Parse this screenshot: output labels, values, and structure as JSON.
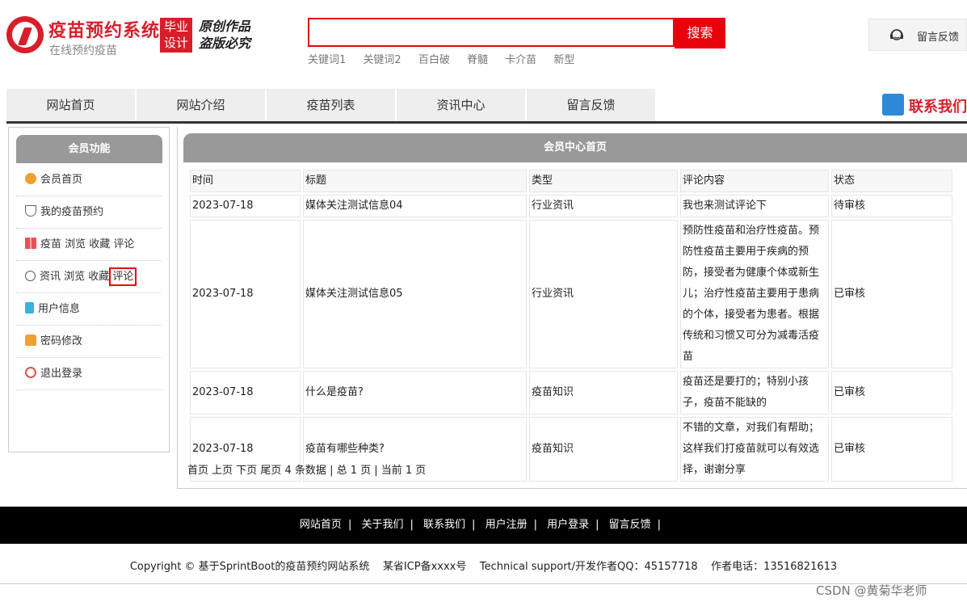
{
  "header": {
    "site_title": "疫苗预约系统",
    "site_subtitle": "在线预约疫苗",
    "badge_line1": "毕业",
    "badge_line2": "设计",
    "slogan_line1": "原创作品",
    "slogan_line2": "盗版必究",
    "search_value": "",
    "search_button": "搜索",
    "keywords": [
      "关键词1",
      "关键词2",
      "百白破",
      "脊髓",
      "卡介苗",
      "新型"
    ],
    "feedback_label": "留言反馈"
  },
  "nav": {
    "items": [
      "网站首页",
      "网站介绍",
      "疫苗列表",
      "资讯中心",
      "留言反馈"
    ],
    "contact_label": "联系我们"
  },
  "sidebar": {
    "title": "会员功能",
    "items": [
      {
        "label": "会员首页",
        "icon": "home-icon",
        "color": "#f0a030"
      },
      {
        "label": "我的疫苗预约",
        "icon": "heart-icon",
        "color": "#666666"
      },
      {
        "label": "疫苗 浏览 收藏 评论",
        "icon": "grid-icon",
        "color": "#e8505a"
      },
      {
        "label": "资讯 浏览 收藏",
        "label_highlight": "评论",
        "icon": "timer-icon",
        "color": "#666666"
      },
      {
        "label": "用户信息",
        "icon": "clipboard-icon",
        "color": "#3ab0e0"
      },
      {
        "label": "密码修改",
        "icon": "lock-icon",
        "color": "#f0a030"
      },
      {
        "label": "退出登录",
        "icon": "power-icon",
        "color": "#e05050"
      }
    ]
  },
  "main": {
    "title": "会员中心首页",
    "columns": [
      "时间",
      "标题",
      "类型",
      "评论内容",
      "状态"
    ],
    "rows": [
      {
        "time": "2023-07-18",
        "title": "媒体关注测试信息04",
        "type": "行业资讯",
        "comment": "我也来测试评论下",
        "status": "待审核"
      },
      {
        "time": "2023-07-18",
        "title": "媒体关注测试信息05",
        "type": "行业资讯",
        "comment": "预防性疫苗和治疗性疫苗。预防性疫苗主要用于疾病的预防，接受者为健康个体或新生儿；治疗性疫苗主要用于患病的个体，接受者为患者。根据传统和习惯又可分为减毒活疫苗",
        "status": "已审核"
      },
      {
        "time": "2023-07-18",
        "title": "什么是疫苗?",
        "type": "疫苗知识",
        "comment": "疫苗还是要打的；特别小孩子，疫苗不能缺的",
        "status": "已审核"
      },
      {
        "time": "2023-07-18",
        "title": "疫苗有哪些种类?",
        "type": "疫苗知识",
        "comment": "不错的文章，对我们有帮助；这样我们打疫苗就可以有效选择，谢谢分享",
        "status": "已审核"
      }
    ],
    "pager": "首页 上页 下页 尾页 4 条数据 | 总 1 页 | 当前 1 页"
  },
  "footer": {
    "links": [
      "网站首页",
      "关于我们",
      "联系我们",
      "用户注册",
      "用户登录",
      "留言反馈"
    ],
    "copyright": "Copyright © 基于SprintBoot的疫苗预约网站系统    某省ICP备xxxx号    Technical support/开发作者QQ：45157718    作者电话：13516821613",
    "watermark": "CSDN @黄菊华老师"
  },
  "colors": {
    "brand_red": "#d81e2a",
    "search_red": "#e8000a",
    "header_gray": "#999999"
  }
}
